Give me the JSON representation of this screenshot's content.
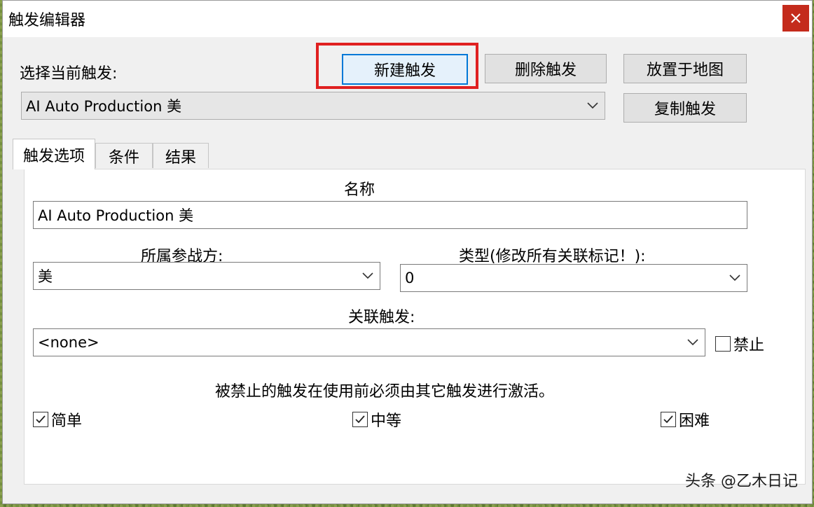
{
  "window": {
    "title": "触发编辑器"
  },
  "header": {
    "select_label": "选择当前触发:",
    "current_trigger": "AI Auto Production 美",
    "buttons": {
      "new": "新建触发",
      "delete": "删除触发",
      "place": "放置于地图",
      "copy": "复制触发"
    }
  },
  "tabs": [
    {
      "label": "触发选项",
      "active": true
    },
    {
      "label": "条件",
      "active": false
    },
    {
      "label": "结果",
      "active": false
    }
  ],
  "options": {
    "name_label": "名称",
    "name_value": "AI Auto Production 美",
    "side_label": "所属参战方:",
    "side_value": "美",
    "type_label": "类型(修改所有关联标记！):",
    "type_value": "0",
    "linked_label": "关联触发:",
    "linked_value": "<none>",
    "disable_label": "禁止",
    "disable_checked": false,
    "note": "被禁止的触发在使用前必须由其它触发进行激活。",
    "difficulty": [
      {
        "label": "简单",
        "checked": true
      },
      {
        "label": "中等",
        "checked": true
      },
      {
        "label": "困难",
        "checked": true
      }
    ]
  },
  "watermark": "头条 @乙木日记",
  "colors": {
    "highlight": "#e02020",
    "close": "#c42b1c",
    "focus": "#0078d7"
  }
}
